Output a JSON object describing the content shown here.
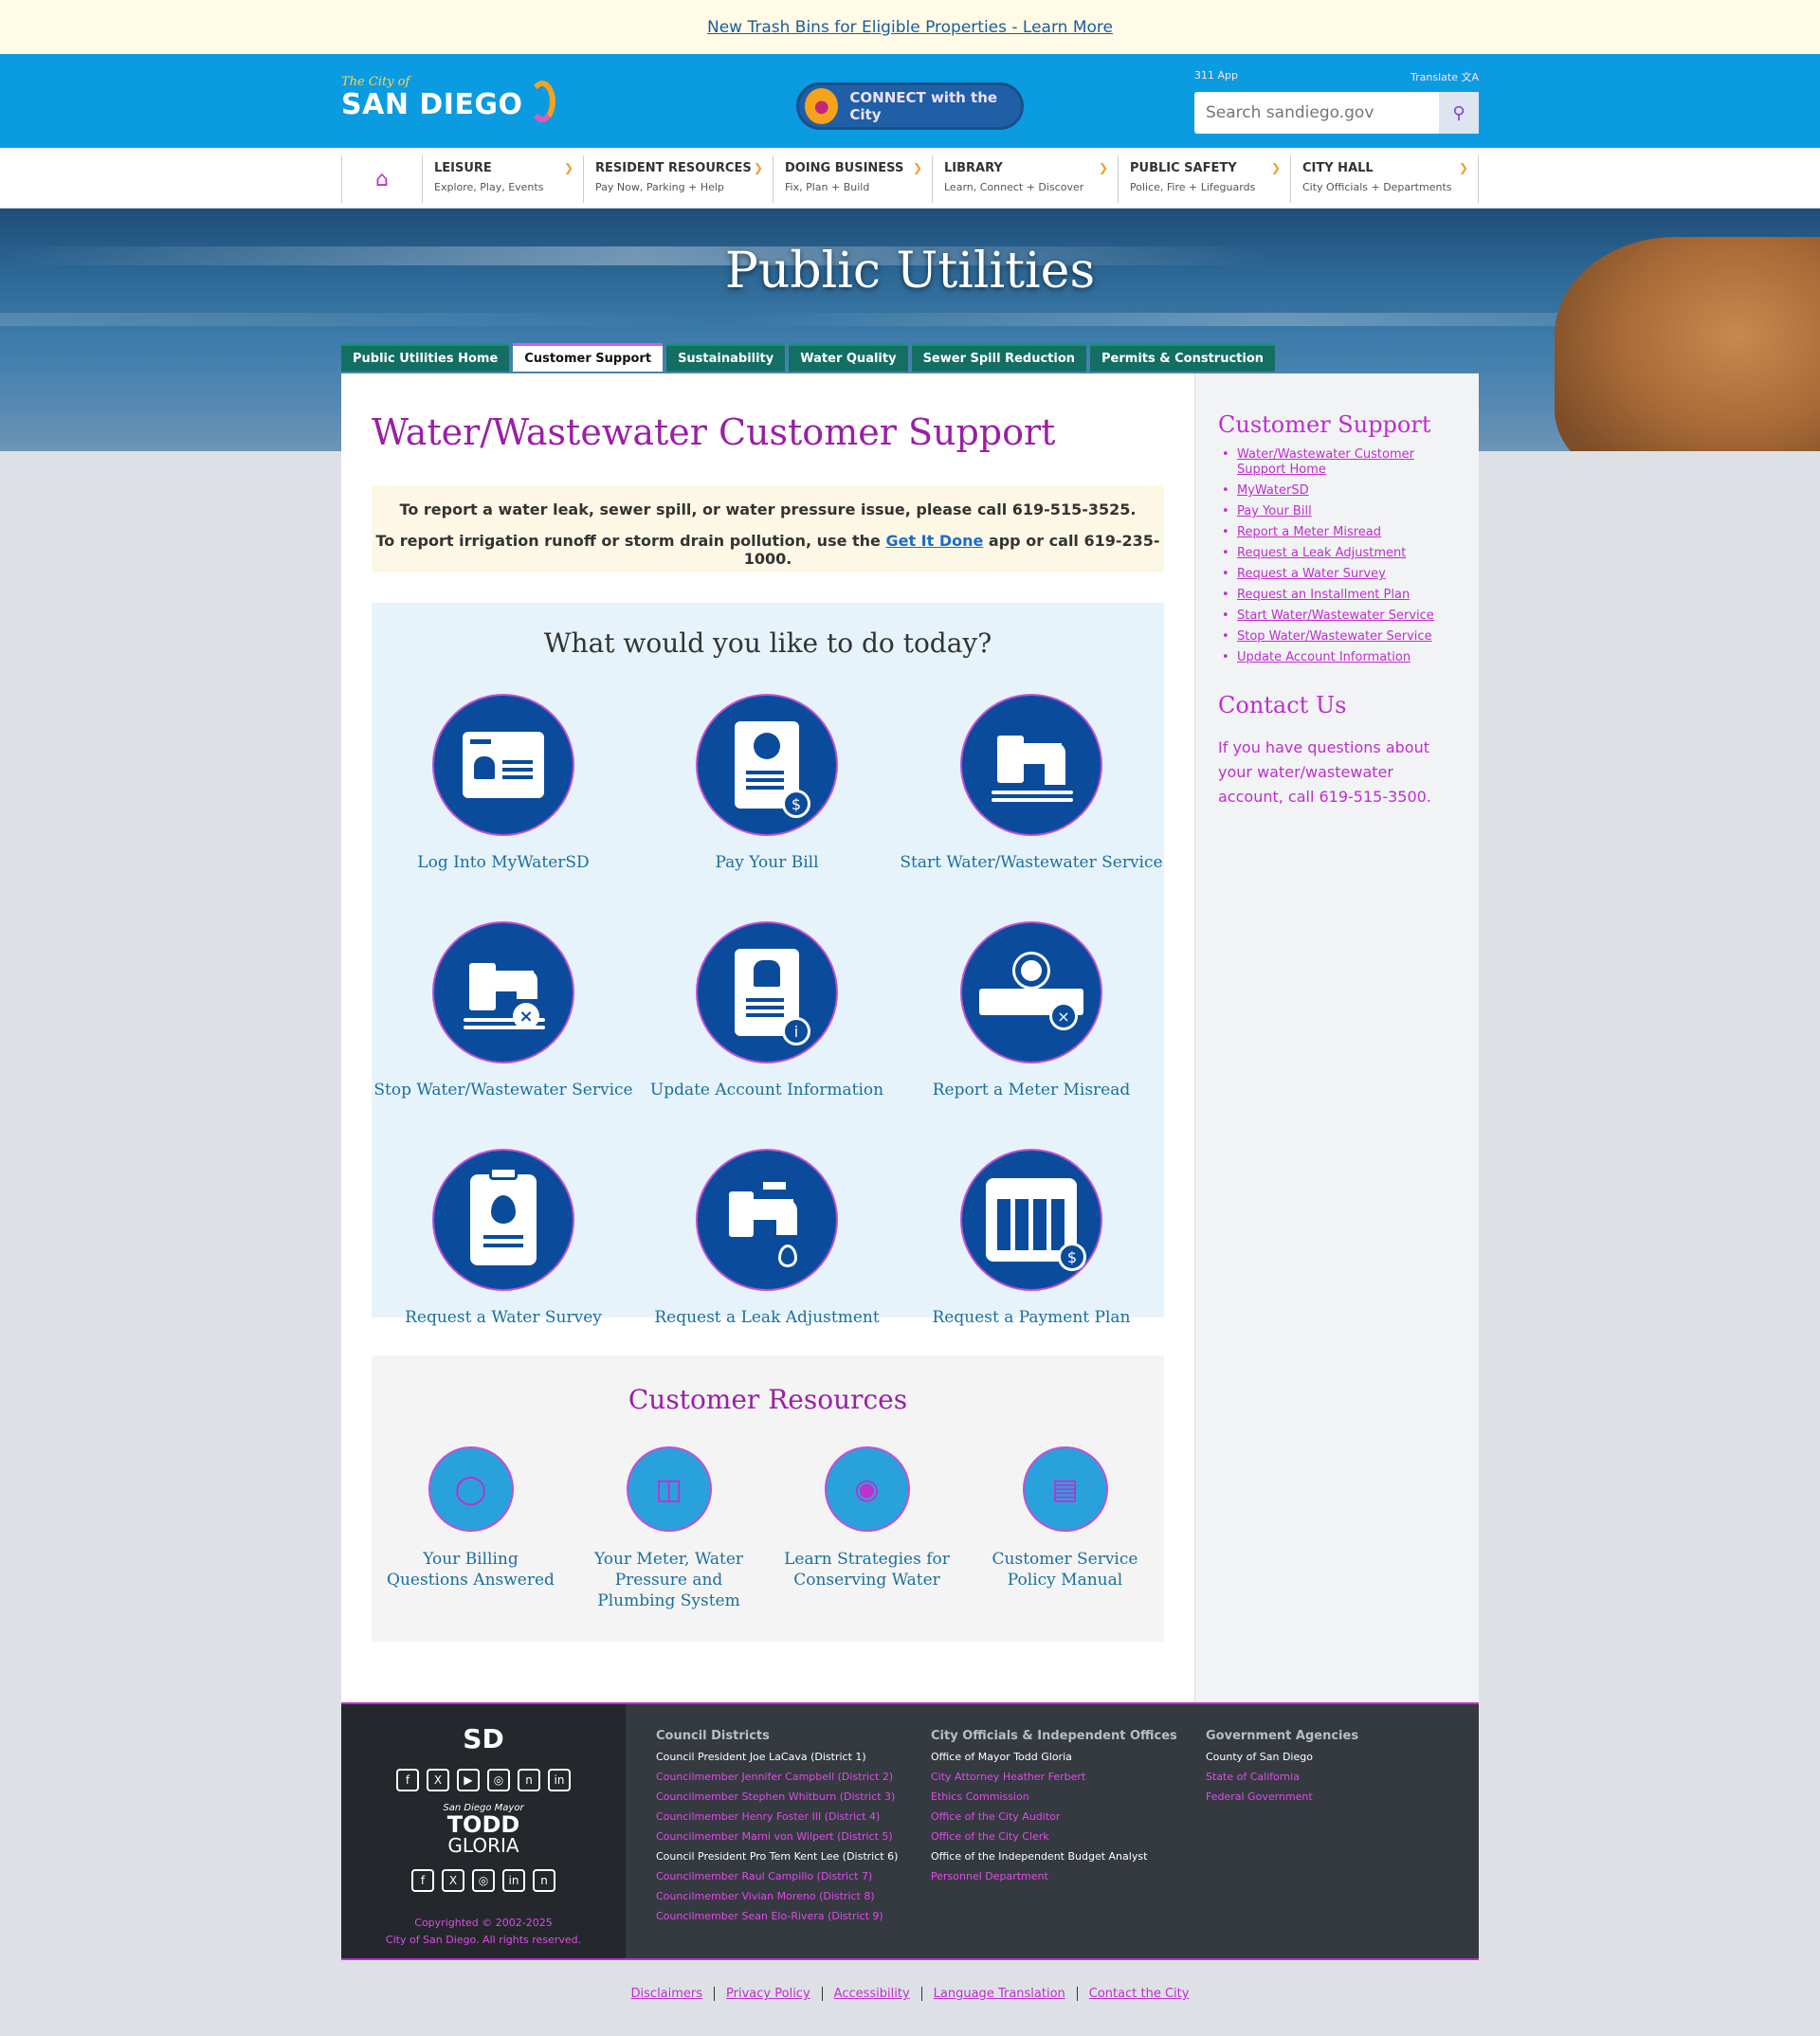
{
  "alert": {
    "text": "New Trash Bins for Eligible Properties - Learn More"
  },
  "header": {
    "logo_small": "The City of",
    "logo_big": "SAN DIEGO",
    "connect_label": "CONNECT with the City",
    "link_left": "311 App",
    "link_right": "Translate",
    "search_placeholder": "Search sandiego.gov"
  },
  "nav": {
    "items": [
      {
        "title": "LEISURE",
        "sub": "Explore, Play, Events"
      },
      {
        "title": "RESIDENT RESOURCES",
        "sub": "Pay Now, Parking + Help"
      },
      {
        "title": "DOING BUSINESS",
        "sub": "Fix, Plan + Build"
      },
      {
        "title": "LIBRARY",
        "sub": "Learn, Connect + Discover"
      },
      {
        "title": "PUBLIC SAFETY",
        "sub": "Police, Fire + Lifeguards"
      },
      {
        "title": "CITY HALL",
        "sub": "City Officials + Departments"
      }
    ]
  },
  "hero": {
    "title": "Public Utilities"
  },
  "tabs": [
    "Public Utilities Home",
    "Customer Support",
    "Sustainability",
    "Water Quality",
    "Sewer Spill Reduction",
    "Permits & Construction"
  ],
  "main": {
    "title": "Water/Wastewater Customer Support",
    "notice1": "To report a water leak, sewer spill, or water pressure issue, please call 619-515-3525.",
    "notice2_pre": "To report irrigation runoff or storm drain pollution, use the ",
    "notice2_link": "Get It Done",
    "notice2_post": " app or call 619-235-1000.",
    "todo_heading": "What would you like to do today?",
    "tiles": [
      "Log Into MyWaterSD",
      "Pay Your Bill",
      "Start Water/Wastewater Service",
      "Stop Water/Wastewater Service",
      "Update Account Information",
      "Report a Meter Misread",
      "Request a Water Survey",
      "Request a Leak Adjustment",
      "Request a Payment Plan"
    ],
    "resources_heading": "Customer Resources",
    "resources": [
      "Your Billing Questions Answered",
      "Your Meter, Water Pressure and Plumbing System",
      "Learn Strategies for Conserving Water",
      "Customer Service Policy Manual"
    ]
  },
  "sidebar": {
    "heading": "Customer Support",
    "links": [
      "Water/Wastewater Customer Support Home",
      "MyWaterSD",
      "Pay Your Bill",
      "Report a Meter Misread",
      "Request a Leak Adjustment",
      "Request a Water Survey",
      "Request an Installment Plan",
      "Start Water/Wastewater Service",
      "Stop Water/Wastewater Service",
      "Update Account Information"
    ],
    "contact_heading": "Contact Us",
    "contact_text": "If you have questions about your water/wastewater account, call 619-515-3500."
  },
  "footer": {
    "sd_logo": "SD",
    "mayor_small": "San Diego Mayor",
    "mayor_first": "TODD",
    "mayor_last": "GLORIA",
    "copyright1": "Copyrighted © 2002-2025",
    "copyright2": "City of San Diego. All rights reserved.",
    "col1_heading": "Council Districts",
    "col1": [
      "Council President Joe LaCava (District 1)",
      "Councilmember Jennifer Campbell (District 2)",
      "Councilmember Stephen Whitburn (District 3)",
      "Councilmember Henry Foster III (District 4)",
      "Councilmember Marni von Wilpert (District 5)",
      "Council President Pro Tem Kent Lee (District 6)",
      "Councilmember Raul Campillo (District 7)",
      "Councilmember Vivian Moreno (District 8)",
      "Councilmember Sean Elo-Rivera (District 9)"
    ],
    "col2_heading": "City Officials & Independent Offices",
    "col2": [
      "Office of Mayor Todd Gloria",
      "City Attorney Heather Ferbert",
      "Ethics Commission",
      "Office of the City Auditor",
      "Office of the City Clerk",
      "Office of the Independent Budget Analyst",
      "Personnel Department"
    ],
    "col3_heading": "Government Agencies",
    "col3": [
      "County of San Diego",
      "State of California",
      "Federal Government"
    ]
  },
  "bottom_links": [
    "Disclaimers",
    "Privacy Policy",
    "Accessibility",
    "Language Translation",
    "Contact the City"
  ]
}
